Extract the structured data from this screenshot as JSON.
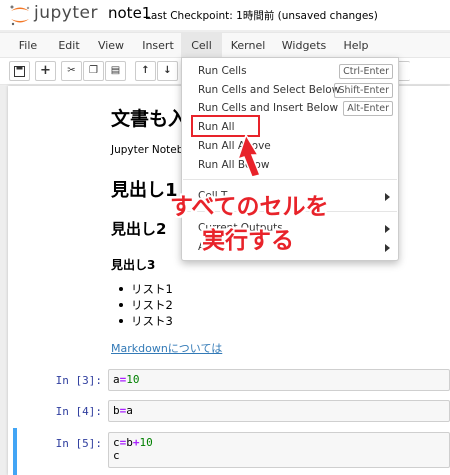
{
  "header": {
    "brand": "jupyter",
    "notebook_name": "note1",
    "checkpoint": "Last Checkpoint: 1時間前  (unsaved changes)"
  },
  "menubar": {
    "items": [
      "File",
      "Edit",
      "View",
      "Insert",
      "Cell",
      "Kernel",
      "Widgets",
      "Help"
    ],
    "active": "Cell"
  },
  "toolbar": {
    "icons": [
      "save-icon",
      "plus-icon",
      "cut-icon",
      "copy-icon",
      "paste-icon",
      "arrow-up-icon",
      "arrow-down-icon"
    ]
  },
  "dropdown": {
    "items": [
      {
        "label": "Run Cells",
        "shortcut": "Ctrl-Enter"
      },
      {
        "label": "Run Cells and Select Below",
        "shortcut": "Shift-Enter"
      },
      {
        "label": "Run Cells and Insert Below",
        "shortcut": "Alt-Enter"
      },
      {
        "label": "Run All",
        "shortcut": ""
      },
      {
        "label": "Run All Above",
        "shortcut": ""
      },
      {
        "label": "Run All Below",
        "shortcut": ""
      },
      {
        "label": "Cell T",
        "shortcut": ""
      },
      {
        "label": "Current Outputs",
        "shortcut": ""
      },
      {
        "label": "All",
        "shortcut": ""
      }
    ]
  },
  "annotation": {
    "line1": "すべてのセルを",
    "line2": "実行する",
    "color": "#e8232a"
  },
  "markdown": {
    "h1": "文書も入",
    "paragraph": "Jupyter Notebo",
    "h1b": "見出し1",
    "h2": "見出し2",
    "h3": "見出し3",
    "list": [
      "リスト1",
      "リスト2",
      "リスト3"
    ],
    "link": "Markdownについては"
  },
  "cells": [
    {
      "prompt": "In [3]:",
      "code": [
        "a=10"
      ]
    },
    {
      "prompt": "In [4]:",
      "code": [
        "b=a"
      ]
    },
    {
      "prompt": "In [5]:",
      "code": [
        "c=b+10",
        "c"
      ]
    }
  ],
  "colors": {
    "accent": "#e8232a",
    "selection": "#42a5f5",
    "prompt": "#303f9f",
    "link": "#337ab7"
  }
}
